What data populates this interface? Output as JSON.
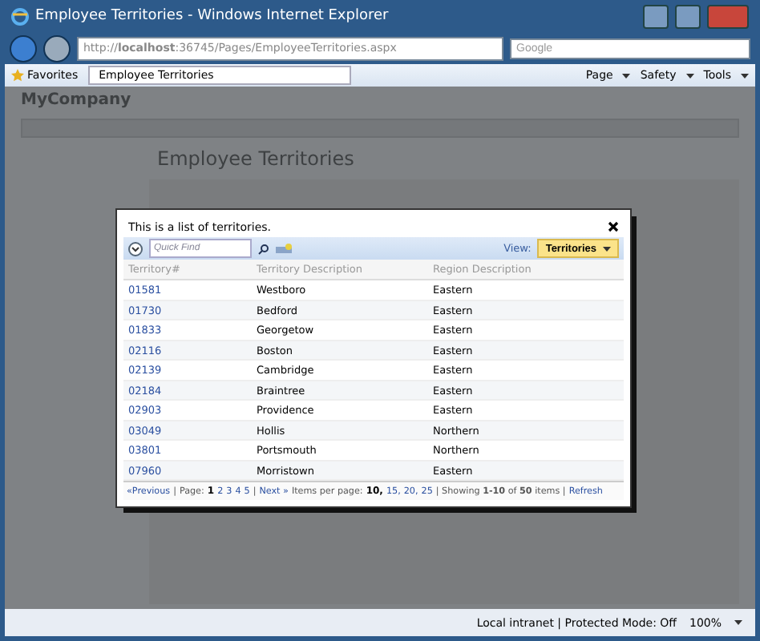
{
  "window": {
    "title": "Employee Territories - Windows Internet Explorer"
  },
  "address_bar": {
    "url": "http://**localhost**:36745/Pages/EmployeeTerritories.aspx"
  },
  "search": {
    "placeholder": "Google"
  },
  "favorites": {
    "label": "Favorites"
  },
  "tab": {
    "label": "Employee Territories"
  },
  "command_bar": [
    "Page",
    "Safety",
    "Tools"
  ],
  "background_page": {
    "brand": "MyCompany",
    "heading": "Employee Territories"
  },
  "dialog": {
    "message": "This is a list of territories.",
    "quick_find": {
      "placeholder": "Quick Find"
    },
    "view_label": "View:",
    "view": "Territories",
    "columns": [
      "Territory#",
      "Territory Description",
      "Region Description"
    ],
    "rows": [
      {
        "id": "01581",
        "description": "Westboro",
        "region": "Eastern"
      },
      {
        "id": "01730",
        "description": "Bedford",
        "region": "Eastern"
      },
      {
        "id": "01833",
        "description": "Georgetow",
        "region": "Eastern"
      },
      {
        "id": "02116",
        "description": "Boston",
        "region": "Eastern"
      },
      {
        "id": "02139",
        "description": "Cambridge",
        "region": "Eastern"
      },
      {
        "id": "02184",
        "description": "Braintree",
        "region": "Eastern"
      },
      {
        "id": "02903",
        "description": "Providence",
        "region": "Eastern"
      },
      {
        "id": "03049",
        "description": "Hollis",
        "region": "Northern"
      },
      {
        "id": "03801",
        "description": "Portsmouth",
        "region": "Northern"
      },
      {
        "id": "07960",
        "description": "Morristown",
        "region": "Eastern"
      }
    ],
    "pager": {
      "previous": "«Previous",
      "page_label": "Page:",
      "pages": [
        {
          "label": "1",
          "selected": true
        },
        {
          "label": "2",
          "selected": false
        },
        {
          "label": "3",
          "selected": false
        },
        {
          "label": "4",
          "selected": false
        },
        {
          "label": "5",
          "selected": false
        }
      ],
      "separator": "|",
      "next": "Next »",
      "items_per_page_label": "Items per page:",
      "sizes": [
        {
          "label": "10,",
          "selected": true
        },
        {
          "label": "15,",
          "selected": false
        },
        {
          "label": "20,",
          "selected": false
        },
        {
          "label": "25",
          "selected": false
        }
      ],
      "showing": "| Showing **1-10** of **50** items |",
      "refresh": "Refresh"
    }
  },
  "status_bar": {
    "zone": "Local intranet | Protected Mode: Off",
    "zoom": "100%"
  }
}
